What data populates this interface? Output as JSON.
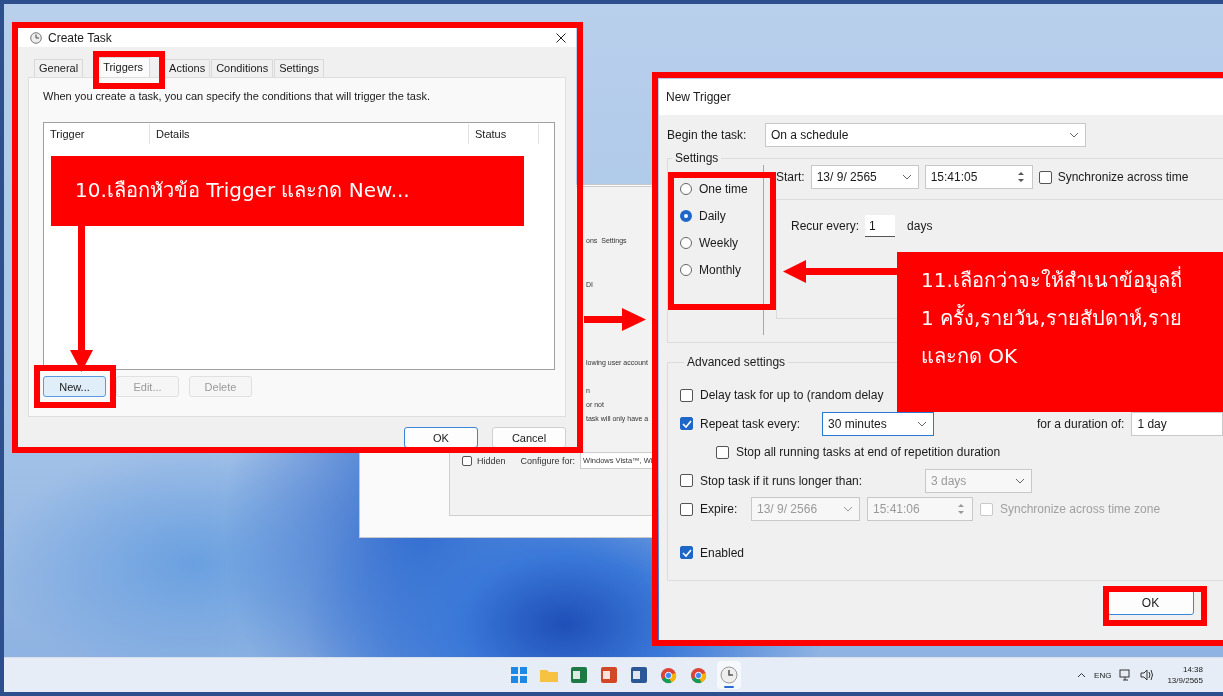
{
  "create_task": {
    "title": "Create Task",
    "tabs": [
      {
        "label": "General",
        "selected": false
      },
      {
        "label": "Triggers",
        "selected": true
      },
      {
        "label": "Actions",
        "selected": false
      },
      {
        "label": "Conditions",
        "selected": false
      },
      {
        "label": "Settings",
        "selected": false
      }
    ],
    "description": "When you create a task, you can specify the conditions that will trigger the task.",
    "columns": [
      "Trigger",
      "Details",
      "Status"
    ],
    "list_buttons": [
      {
        "label": "New...",
        "disabled": false
      },
      {
        "label": "Edit...",
        "disabled": true
      },
      {
        "label": "Delete",
        "disabled": true
      }
    ],
    "dialog_buttons": [
      {
        "label": "OK",
        "default": true
      },
      {
        "label": "Cancel",
        "default": false
      }
    ]
  },
  "background_window": {
    "tab_fragment": "ons",
    "tab_label": "Settings",
    "fragment_1": "DI",
    "fragment_2": "lowing user account",
    "fragment_3": "n",
    "fragment_4": "or not",
    "fragment_5": "task will only have a",
    "hidden": {
      "label": "Hidden",
      "checked": false
    },
    "configure_label": "Configure for:",
    "configure_value": "Windows Vista™, Wi"
  },
  "new_trigger": {
    "title": "New Trigger",
    "begin_label": "Begin the task:",
    "begin_value": "On a schedule",
    "settings_label": "Settings",
    "schedules": [
      {
        "label": "One time",
        "selected": false
      },
      {
        "label": "Daily",
        "selected": true
      },
      {
        "label": "Weekly",
        "selected": false
      },
      {
        "label": "Monthly",
        "selected": false
      }
    ],
    "start_label": "Start:",
    "start_date": "13/ 9/ 2565",
    "start_time": "15:41:05",
    "start_sync": {
      "label": "Synchronize across time",
      "checked": false
    },
    "recur_label": "Recur every:",
    "recur_value": "1",
    "recur_unit": "days",
    "advanced_label": "Advanced settings",
    "delay": {
      "label": "Delay task for up to (random delay",
      "checked": false
    },
    "repeat": {
      "label": "Repeat task every:",
      "checked": true,
      "value": "30 minutes",
      "duration_label": "for a duration of:",
      "duration_value": "1 day"
    },
    "stop_all": {
      "label": "Stop all running tasks at end of repetition duration",
      "checked": false
    },
    "stop_long": {
      "label": "Stop task if it runs longer than:",
      "checked": false,
      "value": "3 days"
    },
    "expire": {
      "label": "Expire:",
      "checked": false,
      "date": "13/ 9/ 2566",
      "time": "15:41:06",
      "sync_label": "Synchronize across time zone",
      "sync_checked": false
    },
    "enabled": {
      "label": "Enabled",
      "checked": true
    },
    "ok": "OK"
  },
  "callouts": [
    {
      "lines": [
        "10.เลือกหัวข้อ Trigger และกด New..."
      ]
    },
    {
      "lines": [
        "11.เลือกว่าจะให้สำเนาข้อมูลถี่",
        "1 ครั้ง,รายวัน,รายสัปดาห์,ราย",
        "และกด OK"
      ]
    }
  ],
  "taskbar": {
    "apps": [
      {
        "kind": "start",
        "selected": false
      },
      {
        "kind": "folder",
        "selected": false
      },
      {
        "kind": "spreadsheet",
        "selected": false
      },
      {
        "kind": "slides",
        "selected": false
      },
      {
        "kind": "document",
        "selected": false
      },
      {
        "kind": "browser",
        "selected": false
      },
      {
        "kind": "browser-profile",
        "selected": false
      },
      {
        "kind": "clock",
        "selected": true
      }
    ],
    "language": "ENG",
    "time": "14:38",
    "date": "13/9/2565"
  }
}
